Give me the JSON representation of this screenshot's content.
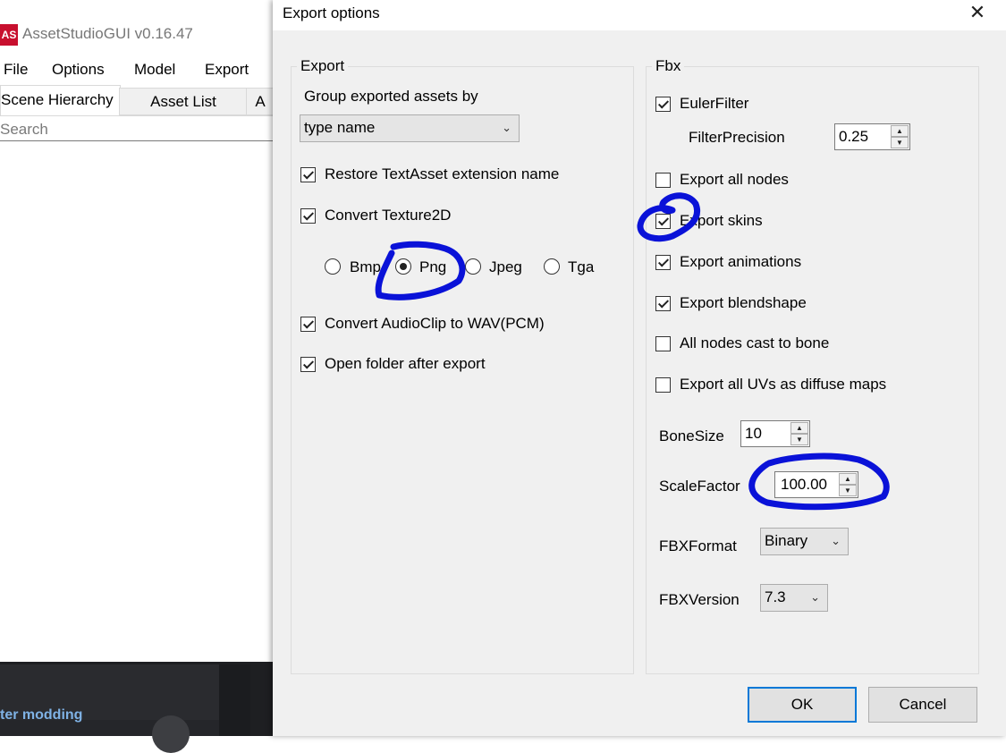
{
  "background_app": {
    "logo_text": "AS",
    "title": "AssetStudioGUI v0.16.47",
    "menu": [
      "File",
      "Options",
      "Model",
      "Export"
    ],
    "tabs": [
      "Scene Hierarchy",
      "Asset List",
      "A"
    ],
    "search_placeholder": "Search",
    "page_snippet": "ter modding"
  },
  "dialog": {
    "title": "Export options",
    "close_glyph": "✕",
    "export_group": {
      "legend": "Export",
      "group_by_label": "Group exported assets by",
      "group_by_value": "type name",
      "restore_textasset": {
        "label": "Restore TextAsset extension name",
        "checked": true
      },
      "convert_texture2d": {
        "label": "Convert Texture2D",
        "checked": true
      },
      "formats": [
        {
          "label": "Bmp",
          "selected": false
        },
        {
          "label": "Png",
          "selected": true
        },
        {
          "label": "Jpeg",
          "selected": false
        },
        {
          "label": "Tga",
          "selected": false
        }
      ],
      "convert_audioclip": {
        "label": "Convert AudioClip to WAV(PCM)",
        "checked": true
      },
      "open_folder": {
        "label": "Open folder after export",
        "checked": true
      }
    },
    "fbx_group": {
      "legend": "Fbx",
      "euler_filter": {
        "label": "EulerFilter",
        "checked": true
      },
      "filter_precision": {
        "label": "FilterPrecision",
        "value": "0.25"
      },
      "export_all_nodes": {
        "label": "Export all nodes",
        "checked": false
      },
      "export_skins": {
        "label": "Export skins",
        "checked": true
      },
      "export_animations": {
        "label": "Export animations",
        "checked": true
      },
      "export_blendshape": {
        "label": "Export blendshape",
        "checked": true
      },
      "all_nodes_bone": {
        "label": "All nodes cast to bone",
        "checked": false
      },
      "export_uvs": {
        "label": "Export all UVs as diffuse maps",
        "checked": false
      },
      "bone_size": {
        "label": "BoneSize",
        "value": "10"
      },
      "scale_factor": {
        "label": "ScaleFactor",
        "value": "100.00"
      },
      "fbx_format": {
        "label": "FBXFormat",
        "value": "Binary"
      },
      "fbx_version": {
        "label": "FBXVersion",
        "value": "7.3"
      }
    },
    "ok_label": "OK",
    "cancel_label": "Cancel"
  },
  "colors": {
    "annotation_ink": "#0a12d8",
    "dialog_bg": "#f0f0f0",
    "primary_border": "#0078d7"
  }
}
